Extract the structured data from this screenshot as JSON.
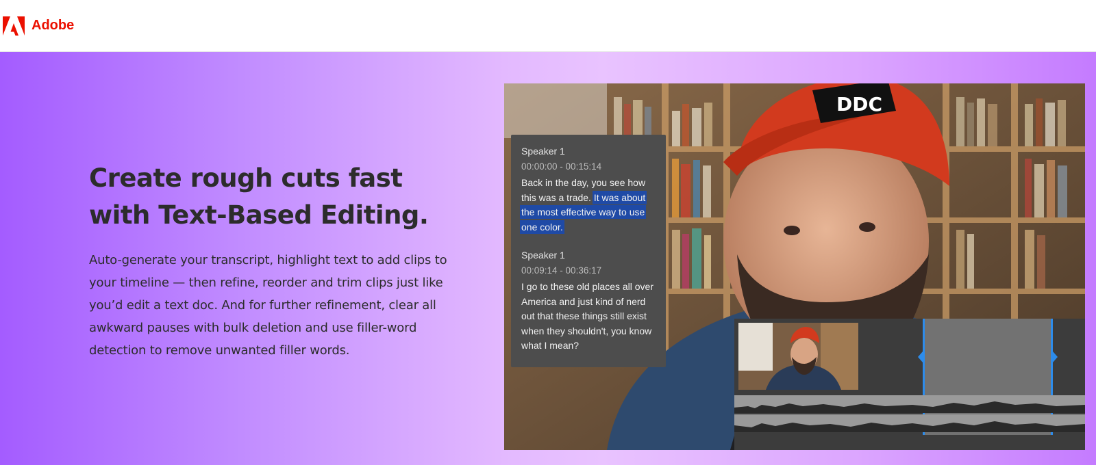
{
  "header": {
    "brand_name": "Adobe",
    "brand_color": "#eb1000",
    "logo_icon": "adobe-logo-icon"
  },
  "hero": {
    "headline": "Create rough cuts fast with Text-Based Editing.",
    "body": "Auto-generate your transcript, highlight text to add clips to your timeline — then refine, reorder and trim clips just like you’d edit a text doc. And for further refinement, clear all awkward pauses with bulk deletion and use filler-word detection to remove unwanted filler words."
  },
  "video": {
    "cap_text": "DDC",
    "transcript": [
      {
        "speaker": "Speaker 1",
        "timecode": "00:00:00 - 00:15:14",
        "text_before": "Back in the day, you see how this was a trade.",
        "text_highlighted": "It was about the most effective way to use one color."
      },
      {
        "speaker": "Speaker 1",
        "timecode": "00:09:14 - 00:36:17",
        "text": "I go to these old places all over America and just kind of nerd out that these things still exist when they shouldn't, you know what I mean?"
      }
    ],
    "highlight_color": "#1f4aa6",
    "playhead_color": "#2d8ceb"
  }
}
